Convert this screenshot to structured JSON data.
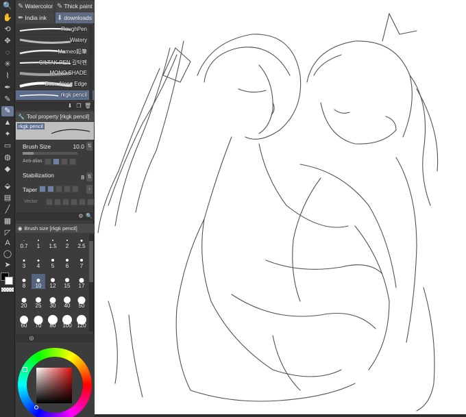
{
  "subtool_tabs": [
    {
      "label": "Watercolor",
      "icon": "brush-icon"
    },
    {
      "label": "Thick paint",
      "icon": "brush-icon"
    },
    {
      "label": "India ink",
      "icon": "pen-icon"
    },
    {
      "label": "downloads",
      "icon": "download-icon"
    }
  ],
  "brushes": [
    {
      "name": "RoughPen"
    },
    {
      "name": "Watery"
    },
    {
      "name": "Mameo鉛筆"
    },
    {
      "name": "GILTAK PEN 길탁펜"
    },
    {
      "name": "MONO SHADE"
    },
    {
      "name": "Base Along Edge"
    },
    {
      "name": "rkgk pencil"
    }
  ],
  "tool_property": {
    "title": "Tool property [rkgk pencil]",
    "preview_label": "rkgk pencil",
    "brush_size_label": "Brush Size",
    "brush_size_value": "10.0",
    "antialias_label": "Anti-alias",
    "stabilization_label": "Stabilization",
    "stabilization_value": "8",
    "taper_label": "Taper",
    "vector_label": "Vector"
  },
  "brush_size_panel": {
    "title": "Brush size [rkgk pencil]",
    "sizes": [
      "0.7",
      "1",
      "1.5",
      "2",
      "2.5",
      "3",
      "4",
      "5",
      "6",
      "7",
      "8",
      "10",
      "12",
      "15",
      "17",
      "20",
      "25",
      "30",
      "40",
      "50",
      "60",
      "70",
      "80",
      "100",
      "120"
    ],
    "selected": "10"
  },
  "colors": {
    "main": "#000000",
    "sub": "#ffffff",
    "accent_selection": "#5d6d8c",
    "wheel_hue": "#e01010"
  }
}
